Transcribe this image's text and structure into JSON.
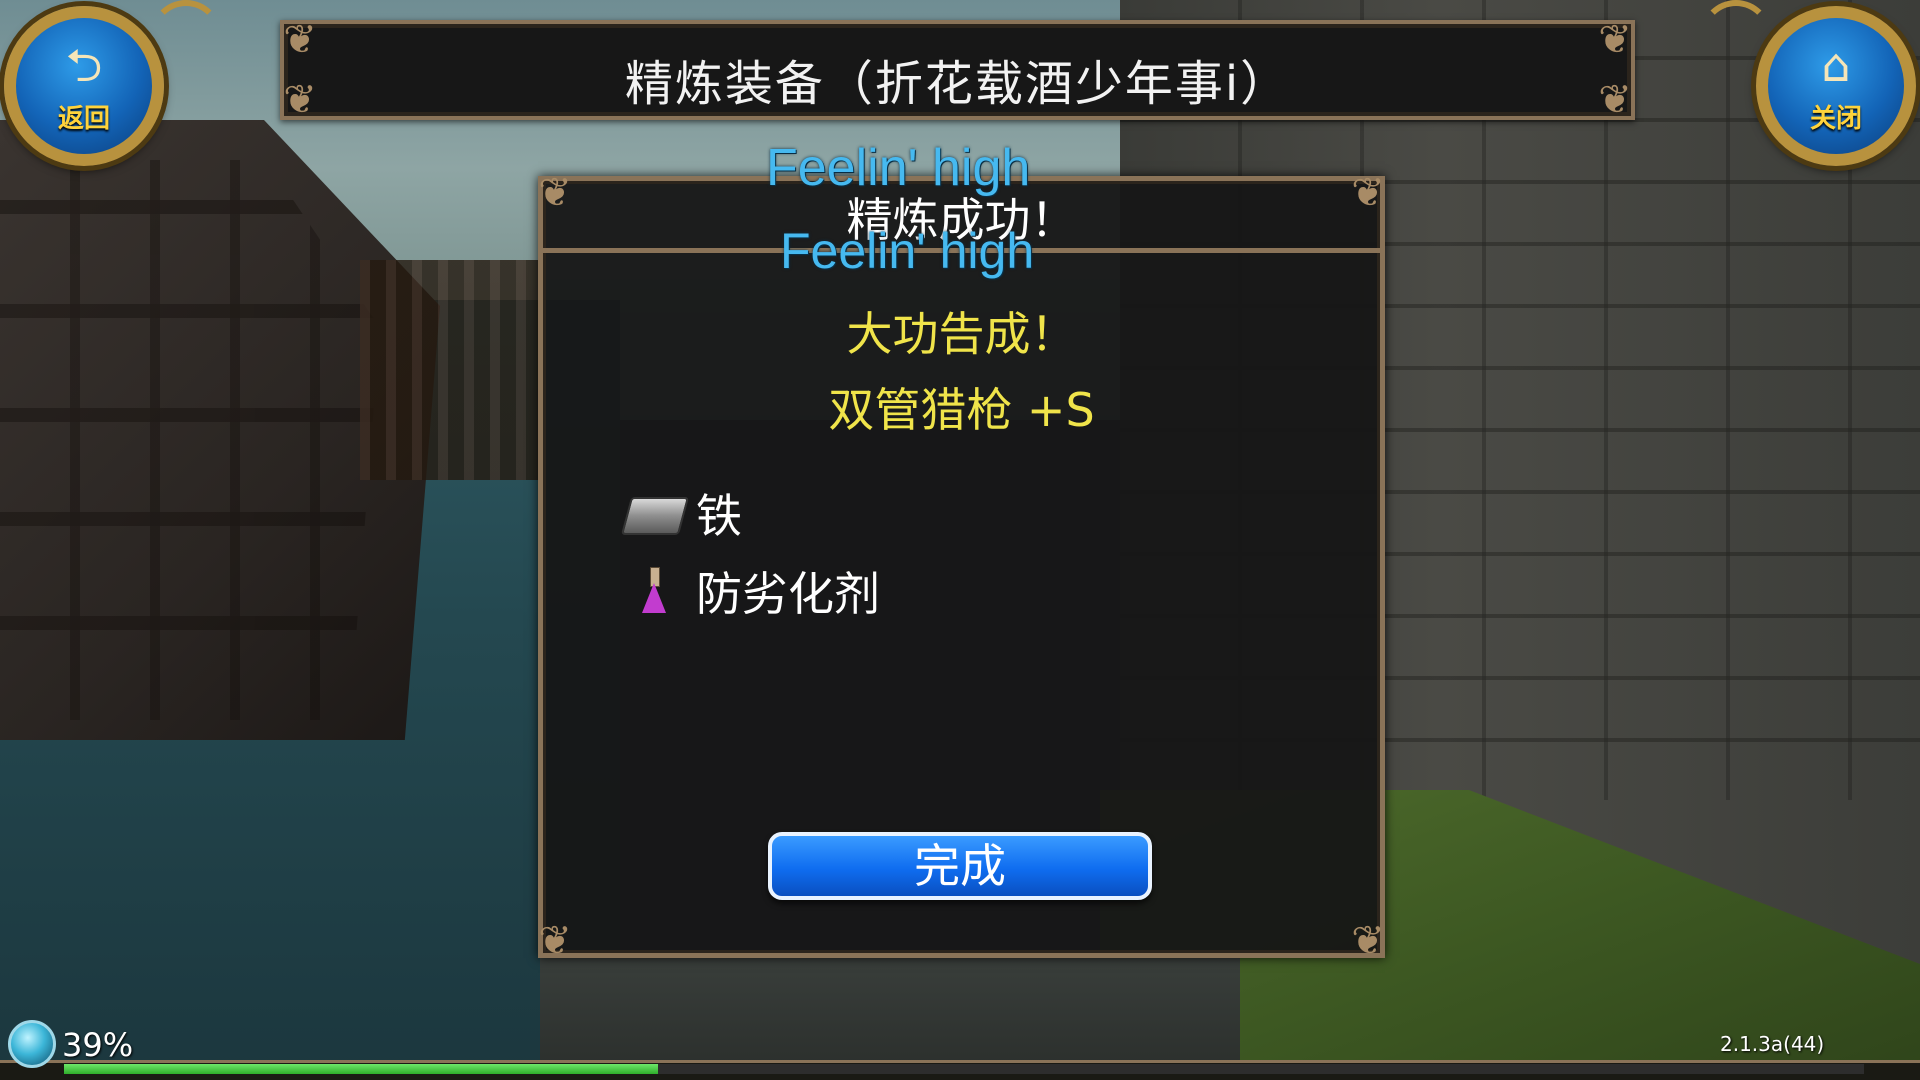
{
  "header": {
    "title": "精炼装备（折花载酒少年事i）"
  },
  "back_button": {
    "icon": "undo-arrow-icon",
    "label": "返回"
  },
  "close_button": {
    "icon": "home-icon",
    "label": "关闭"
  },
  "dialog": {
    "title": "精炼成功！",
    "overlay_lyrics": [
      "Feelin' high",
      "Feelin' high"
    ],
    "result_text": "大功告成！",
    "item_name": "双管猎枪 +S",
    "materials": [
      {
        "icon": "iron-ingot-icon",
        "name": "铁"
      },
      {
        "icon": "potion-flask-icon",
        "name": "防劣化剂"
      }
    ],
    "done_label": "完成"
  },
  "status": {
    "percent_text": "39%",
    "progress": 0.33,
    "version": "2.1.3a(44)"
  },
  "colors": {
    "frame": "#8a7358",
    "success_yellow": "#f0e44a",
    "button_blue": "#0f6df0",
    "lyric_blue": "#46b9f0",
    "progress_green": "#2fae2b"
  }
}
